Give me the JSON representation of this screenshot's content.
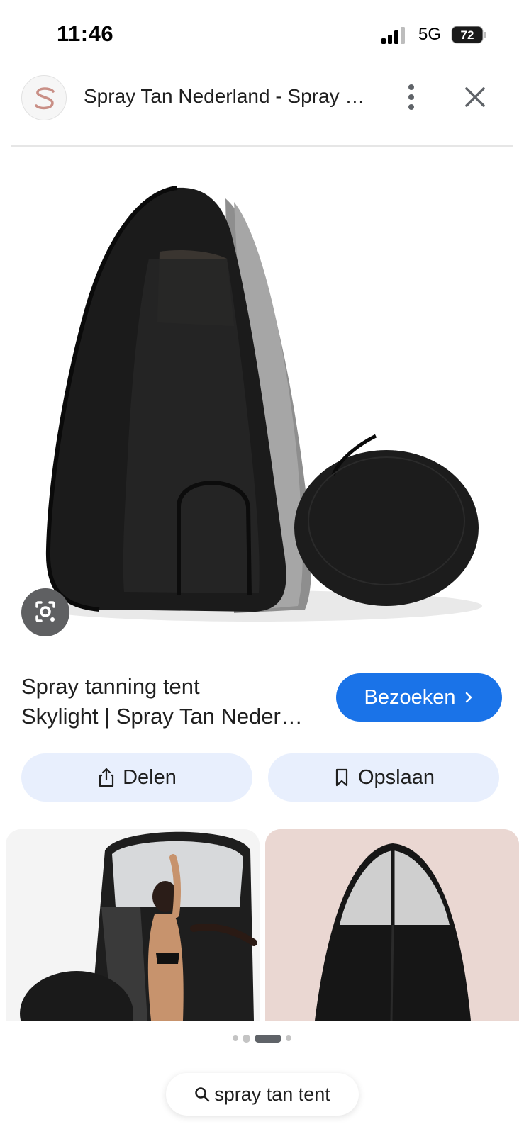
{
  "status_bar": {
    "time": "11:46",
    "network": "5G",
    "battery": "72"
  },
  "header": {
    "site_title": "Spray Tan Nederland - Spray tanning tent Skylight",
    "logo_icon": "s-logo-icon",
    "more_icon": "more-vert-icon",
    "close_icon": "close-icon"
  },
  "main_image": {
    "alt": "black pop-up tent with storage bag",
    "lens_icon": "google-lens-icon"
  },
  "result": {
    "title_line1": "Spray tanning tent",
    "title_line2": "Skylight | Spray Tan Nederland",
    "visit_label": "Bezoeken",
    "share_label": "Delen",
    "save_label": "Opslaan"
  },
  "search_chip": {
    "label": "spray tan tent"
  },
  "colors": {
    "accent": "#1a73e8",
    "pill_bg": "#e8effd",
    "lens_bg": "#5f6062"
  }
}
